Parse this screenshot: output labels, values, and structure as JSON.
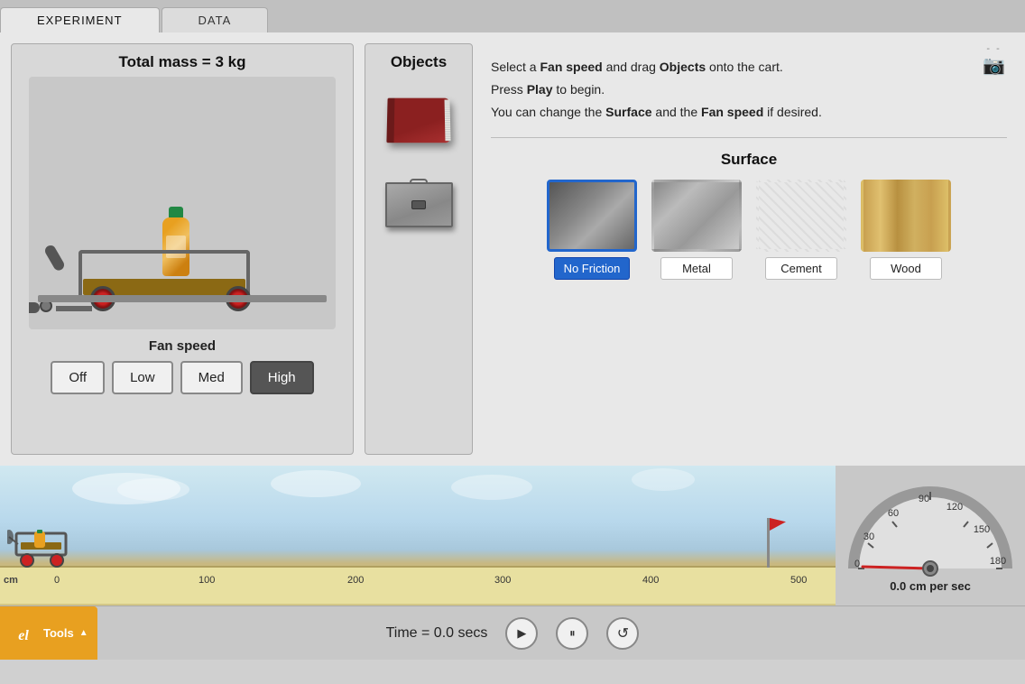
{
  "tabs": [
    {
      "id": "experiment",
      "label": "EXPERIMENT",
      "active": true
    },
    {
      "id": "data",
      "label": "DATA",
      "active": false
    }
  ],
  "cart_panel": {
    "mass_label": "Total mass = 3 kg",
    "fan_speed_label": "Fan speed",
    "speed_buttons": [
      {
        "label": "Off",
        "active": false
      },
      {
        "label": "Low",
        "active": false
      },
      {
        "label": "Med",
        "active": false
      },
      {
        "label": "High",
        "active": true
      }
    ]
  },
  "objects_panel": {
    "title": "Objects",
    "items": [
      {
        "name": "book",
        "label": "Book"
      },
      {
        "name": "metal-box",
        "label": "Metal box"
      }
    ]
  },
  "instructions": {
    "line1": "Select a ",
    "fan_speed_bold": "Fan speed",
    "line1b": " and drag ",
    "objects_bold": "Objects",
    "line1c": " onto the cart.",
    "line2": "Press ",
    "play_bold": "Play",
    "line2b": " to begin.",
    "line3": "You can change the ",
    "surface_bold": "Surface",
    "line3b": " and the ",
    "fan_speed2_bold": "Fan speed",
    "line3c": " if desired."
  },
  "surface": {
    "title": "Surface",
    "options": [
      {
        "id": "no-friction",
        "label": "No Friction",
        "selected": true
      },
      {
        "id": "metal",
        "label": "Metal",
        "selected": false
      },
      {
        "id": "cement",
        "label": "Cement",
        "selected": false
      },
      {
        "id": "wood",
        "label": "Wood",
        "selected": false
      }
    ]
  },
  "track": {
    "cm_label": "cm",
    "markers": [
      "0",
      "100",
      "200",
      "300",
      "400",
      "500"
    ]
  },
  "speedometer": {
    "value": "0.0",
    "unit": "cm per sec",
    "label": "0.0 cm per sec",
    "ticks": [
      "0",
      "30",
      "60",
      "90",
      "120",
      "150",
      "180"
    ]
  },
  "controls": {
    "time_label": "Time = 0.0 secs",
    "play_label": "▶",
    "pause_label": "⏸",
    "reset_label": "↺",
    "tools_label": "Tools"
  }
}
